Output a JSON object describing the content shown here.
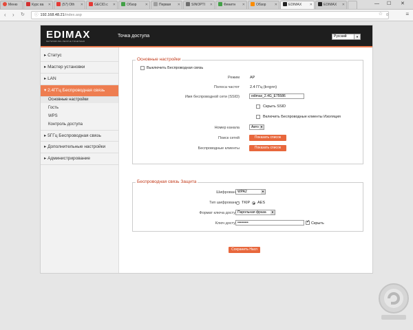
{
  "browser": {
    "tabs": [
      {
        "label": "Меню",
        "color": "#e54a3a"
      },
      {
        "label": "Курс ва",
        "color": "#d32f2f"
      },
      {
        "label": "(57) Oth",
        "color": "#e53935"
      },
      {
        "label": "GECID.c",
        "color": "#e53935"
      },
      {
        "label": "Обзор",
        "color": "#43a047"
      },
      {
        "label": "Первая",
        "color": "#9e9e9e"
      },
      {
        "label": "SINOPTI",
        "color": "#6d6d6d"
      },
      {
        "label": "Финитн",
        "color": "#43a047"
      },
      {
        "label": "Обзор",
        "color": "#fb8c00"
      },
      {
        "label": "EDIMAX",
        "color": "#222222"
      },
      {
        "label": "EDIMAX",
        "color": "#222222"
      }
    ],
    "window_controls": [
      "—",
      "☐",
      "✕"
    ],
    "url_host": "192.168.48.21",
    "url_path": "/index.asp",
    "badge": "0"
  },
  "header": {
    "logo_word": "EDIMAX",
    "logo_tagline": "NETWORKING PEOPLE TOGETHER",
    "title": "Точка доступа",
    "language": "Русский"
  },
  "sidebar": {
    "items": [
      {
        "label": "▸ Статус"
      },
      {
        "label": "▸ Мастер установки"
      },
      {
        "label": "▸ LAN"
      },
      {
        "label": "▾ 2.4ГГц Беспроводная связь"
      },
      {
        "label": "▸ 5ГГц Беспроводная связь"
      },
      {
        "label": "▸ Дополнительные настройки"
      },
      {
        "label": "▸ Администрирование"
      }
    ],
    "subitems": [
      {
        "label": "Основные настройки"
      },
      {
        "label": "Гость"
      },
      {
        "label": "WPS"
      },
      {
        "label": "Контроль доступа"
      }
    ]
  },
  "basic": {
    "legend": "Основные настройки",
    "disable_label": "Выключить  Беспроводная связь",
    "mode_label": "Режим",
    "mode_value": "AP",
    "band_label": "Полоса частот",
    "band_value": "2.4 ГГц (b+g+n)",
    "ssid_label": "Имя беспроводной сети  (SSID)",
    "ssid_value": "edimax_2.4G_E75586",
    "hide_ssid": "Скрыть SSID",
    "isolation": "Включить Беспроводные клиенты Изоляция",
    "channel_label": "Номер канала",
    "channel_value": "Авто",
    "scan_label": "Поиск сетей",
    "scan_button": "Показать список",
    "clients_label": "Беспроводные клиенты",
    "clients_button": "Показать список"
  },
  "security": {
    "legend": "Беспроводная связь  Защита",
    "enc_label": "Шифрование",
    "enc_value": "WPA2",
    "cipher_label": "Тип шифрования",
    "tkip": "TKIP",
    "aes": "AES",
    "key_format_label": "Формат ключа доступа",
    "key_format_value": "Парольная фраза",
    "key_label": "Ключ доступа",
    "key_value": "•••••••••",
    "hide_label": "Скрыть"
  },
  "save_button": "Сохранить Насп"
}
